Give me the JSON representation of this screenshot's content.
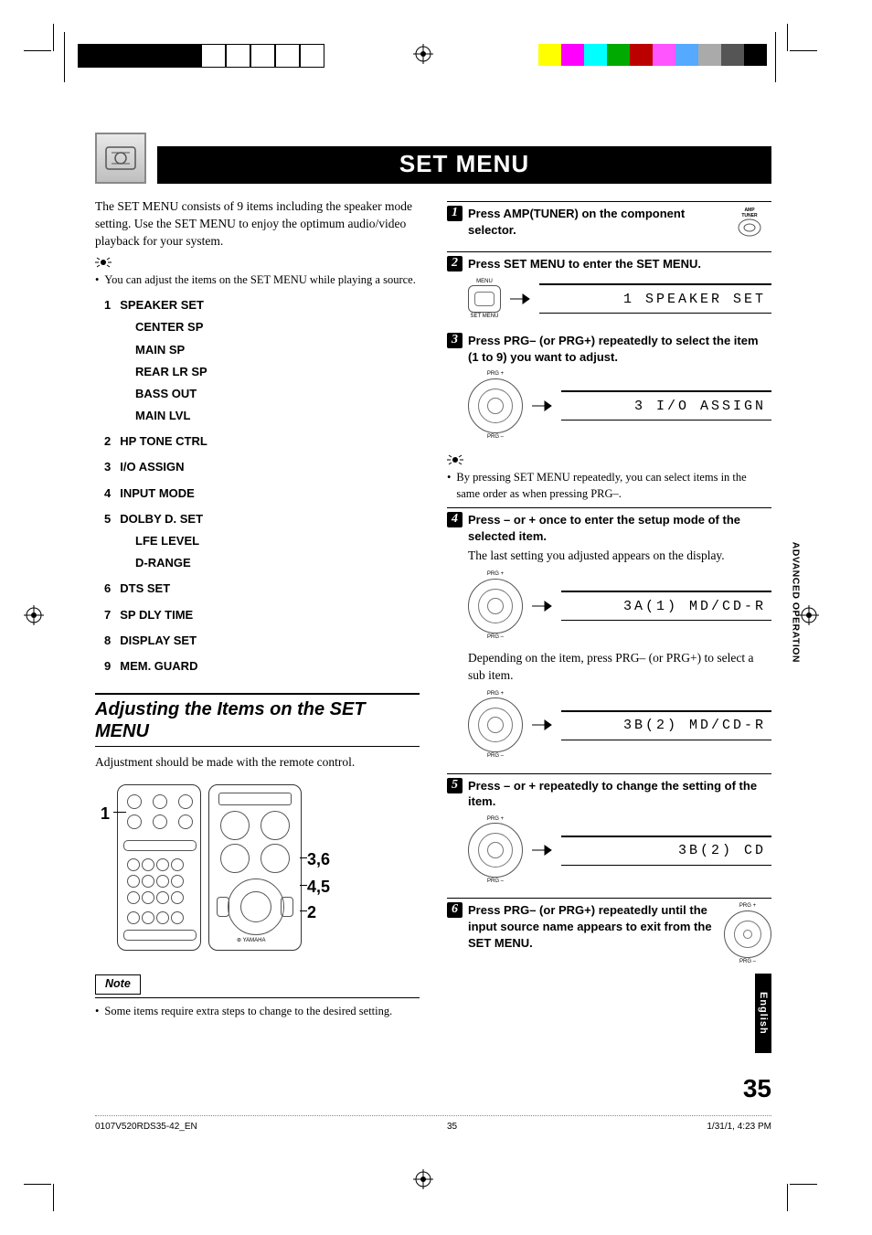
{
  "title": "SET MENU",
  "intro": "The SET MENU consists of 9 items including the speaker mode setting. Use the SET MENU to enjoy the optimum audio/video playback for your system.",
  "intro_hint": "You can adjust the items on the SET MENU while playing a source.",
  "menu": [
    {
      "num": "1",
      "label": "SPEAKER SET",
      "sub": [
        "CENTER SP",
        "MAIN SP",
        "REAR LR SP",
        "BASS OUT",
        "MAIN LVL"
      ]
    },
    {
      "num": "2",
      "label": "HP TONE CTRL"
    },
    {
      "num": "3",
      "label": "I/O ASSIGN"
    },
    {
      "num": "4",
      "label": "INPUT MODE"
    },
    {
      "num": "5",
      "label": "DOLBY D. SET",
      "sub": [
        "LFE LEVEL",
        "D-RANGE"
      ]
    },
    {
      "num": "6",
      "label": "DTS SET"
    },
    {
      "num": "7",
      "label": "SP DLY TIME"
    },
    {
      "num": "8",
      "label": "DISPLAY SET"
    },
    {
      "num": "9",
      "label": "MEM. GUARD"
    }
  ],
  "adjust_heading": "Adjusting the Items on the SET MENU",
  "adjust_text": "Adjustment should be made with the remote control.",
  "callouts": {
    "c1": "1",
    "c36": "3,6",
    "c45": "4,5",
    "c2": "2"
  },
  "note_label": "Note",
  "note_text": "Some items require extra steps to change to the desired setting.",
  "steps": {
    "s1": {
      "n": "1",
      "head": "Press AMP(TUNER) on the component selector."
    },
    "s2": {
      "n": "2",
      "head": "Press SET MENU to enter the SET MENU.",
      "lcd": "1 SPEAKER SET",
      "btn_labels": {
        "top": "MENU",
        "bot": "SET MENU"
      }
    },
    "s3": {
      "n": "3",
      "head": "Press PRG– (or PRG+) repeatedly to select the item (1 to 9) you want to adjust.",
      "lcd": "3 I/O ASSIGN"
    },
    "s3_hint": "By pressing SET MENU repeatedly, you can select items in the same order as when pressing PRG–.",
    "s4": {
      "n": "4",
      "head": "Press – or + once to enter the setup mode of the selected item.",
      "body": "The last setting you adjusted appears on the display.",
      "lcd": "3A(1) MD/CD-R",
      "body2": "Depending on the item, press PRG– (or PRG+) to select a sub item.",
      "lcd2": "3B(2) MD/CD-R"
    },
    "s5": {
      "n": "5",
      "head": "Press – or + repeatedly to change the setting of the item.",
      "lcd": "3B(2)    CD"
    },
    "s6": {
      "n": "6",
      "head": "Press PRG– (or PRG+) repeatedly until the input source name appears to exit from the SET MENU."
    }
  },
  "amp_label_top": "AMP",
  "amp_label_bot": "TUNER",
  "dpad_labels": {
    "top": "PRG +",
    "bot": "PRG –"
  },
  "side_tab": "ADVANCED OPERATION",
  "lang_tab": "English",
  "page_number": "35",
  "footer": {
    "file": "0107V520RDS35-42_EN",
    "page": "35",
    "date": "1/31/1, 4:23 PM"
  }
}
